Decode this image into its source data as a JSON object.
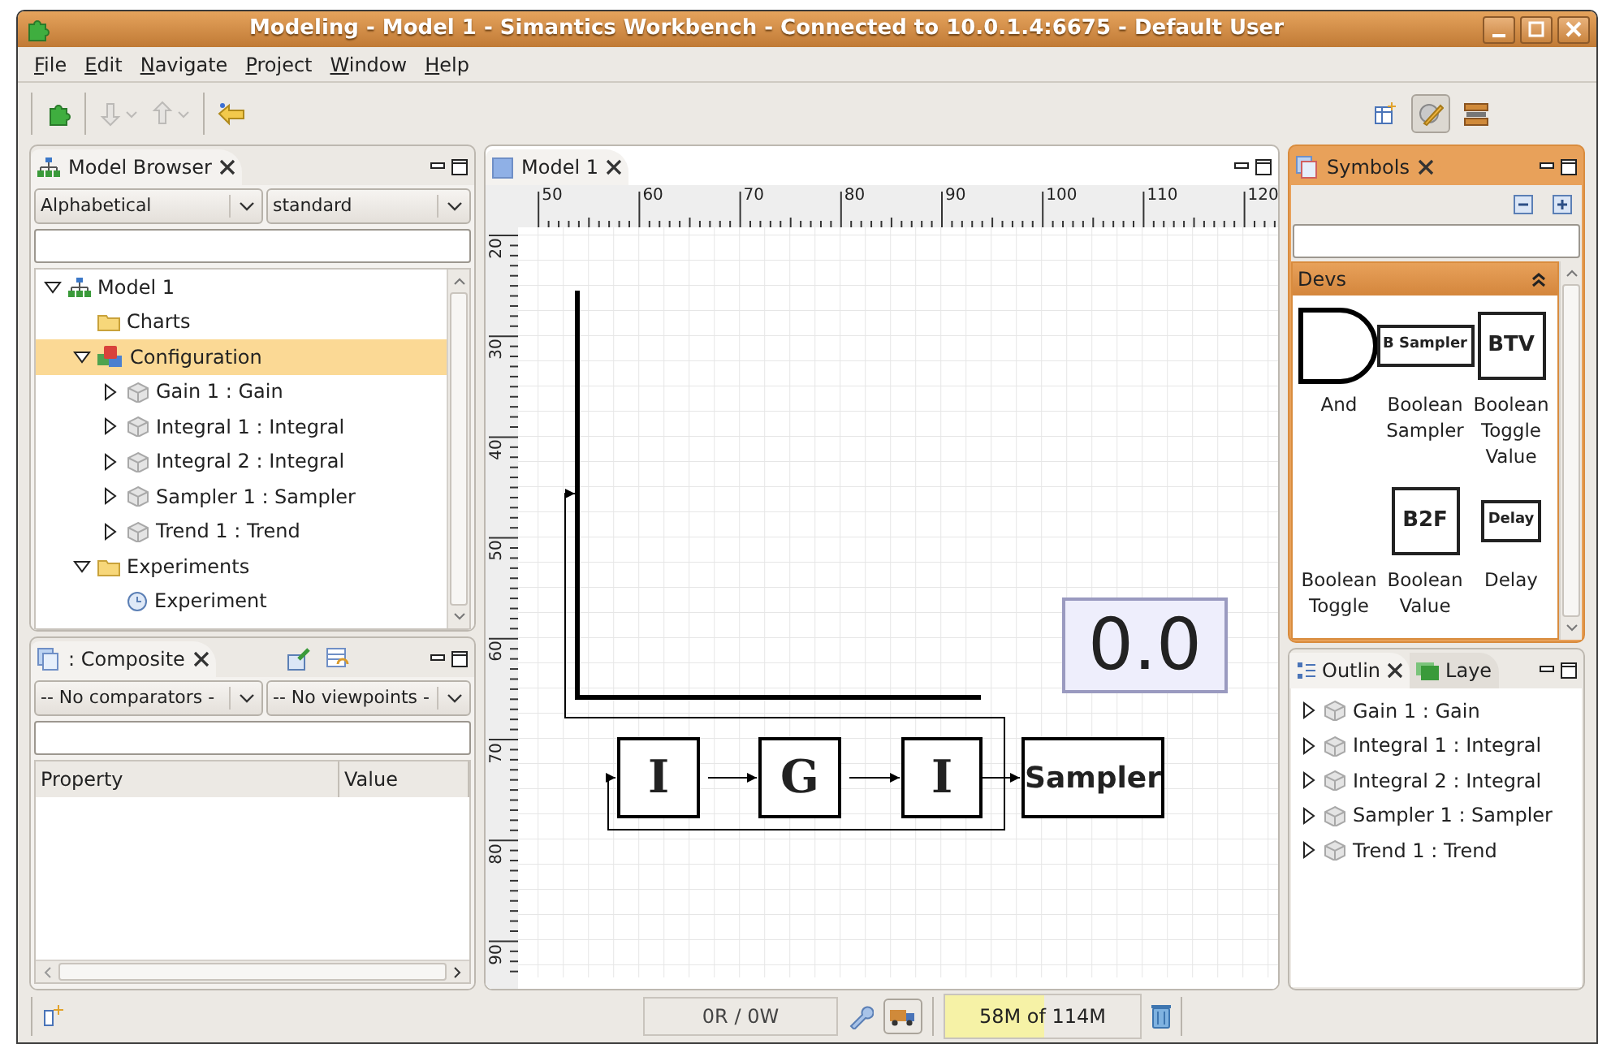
{
  "window": {
    "title": "Modeling - Model 1 - Simantics Workbench - Connected to 10.0.1.4:6675 - Default User"
  },
  "menu": [
    "File",
    "Edit",
    "Navigate",
    "Project",
    "Window",
    "Help"
  ],
  "toolbar": [
    {
      "kind": "puzzle",
      "disabled": false
    },
    {
      "kind": "import",
      "disabled": true
    },
    {
      "kind": "export",
      "disabled": true
    },
    {
      "kind": "back",
      "disabled": false
    }
  ],
  "perspectives": [
    {
      "kind": "new",
      "selected": false
    },
    {
      "kind": "modeling",
      "selected": true
    },
    {
      "kind": "simulation",
      "selected": false
    }
  ],
  "model_browser": {
    "tab": "Model Browser",
    "active": false,
    "sort": "Alphabetical",
    "view": "standard",
    "tree": [
      {
        "label": "Model 1",
        "kind": "model",
        "expanded": true,
        "selected": false,
        "children": [
          {
            "label": "Charts",
            "kind": "folder",
            "selected": false
          },
          {
            "label": "Configuration",
            "kind": "configuration",
            "expanded": true,
            "selected": true,
            "children": [
              {
                "label": "Gain 1 : Gain",
                "kind": "component",
                "expanded": false,
                "selected": false
              },
              {
                "label": "Integral 1 : Integral",
                "kind": "component",
                "expanded": false,
                "selected": false
              },
              {
                "label": "Integral 2 : Integral",
                "kind": "component",
                "expanded": false,
                "selected": false
              },
              {
                "label": "Sampler 1 : Sampler",
                "kind": "component",
                "expanded": false,
                "selected": false
              },
              {
                "label": "Trend 1 : Trend",
                "kind": "component",
                "expanded": false,
                "selected": false
              }
            ]
          },
          {
            "label": "Experiments",
            "kind": "folder",
            "expanded": true,
            "selected": false,
            "children": [
              {
                "label": "Experiment",
                "kind": "experiment",
                "selected": false
              }
            ]
          }
        ]
      }
    ]
  },
  "composite": {
    "tab": ": Composite",
    "active": false,
    "comparator": "-- No comparators -",
    "viewpoint": "-- No viewpoints -",
    "columns": [
      "Property",
      "Value"
    ]
  },
  "editor": {
    "tab": "Model 1",
    "active": false,
    "x_ruler": [
      "50",
      "60",
      "70",
      "80",
      "90",
      "100",
      "110",
      "120"
    ],
    "y_ruler": [
      "20",
      "30",
      "40",
      "50",
      "60",
      "70",
      "80",
      "90"
    ],
    "nodes": [
      {
        "kind": "trend"
      },
      {
        "kind": "display",
        "label": "0.0"
      },
      {
        "kind": "block",
        "label": "I"
      },
      {
        "kind": "block",
        "label": "G"
      },
      {
        "kind": "block",
        "label": "I"
      },
      {
        "kind": "sampler",
        "label": "Sampler"
      }
    ]
  },
  "symbols": {
    "tab": "Symbols",
    "active": true,
    "group": "Devs",
    "expanded": true,
    "items": [
      {
        "label": "And",
        "kind": "and"
      },
      {
        "label": "Boolean Sampler",
        "kind": "box",
        "icon_text": "B Sampler"
      },
      {
        "label": "Boolean Toggle Value",
        "kind": "box",
        "icon_text": "BTV"
      },
      {
        "label": "Boolean Toggle",
        "kind": "none"
      },
      {
        "label": "Boolean Value",
        "kind": "box",
        "icon_text": "B2F"
      },
      {
        "label": "Delay",
        "kind": "box",
        "icon_text": "Delay"
      }
    ]
  },
  "outline": {
    "tabs": [
      {
        "label": "Outlin",
        "selected": true
      },
      {
        "label": "Laye",
        "selected": false
      }
    ],
    "items": [
      {
        "label": "Gain 1 : Gain",
        "expanded": false
      },
      {
        "label": "Integral 1 : Integral",
        "expanded": false
      },
      {
        "label": "Integral 2 : Integral",
        "expanded": false
      },
      {
        "label": "Sampler 1 : Sampler",
        "expanded": false
      },
      {
        "label": "Trend 1 : Trend",
        "expanded": false
      }
    ]
  },
  "status_bar": {
    "io": "0R / 0W",
    "memory": {
      "text": "58M of 114M",
      "level": 0.51
    }
  }
}
